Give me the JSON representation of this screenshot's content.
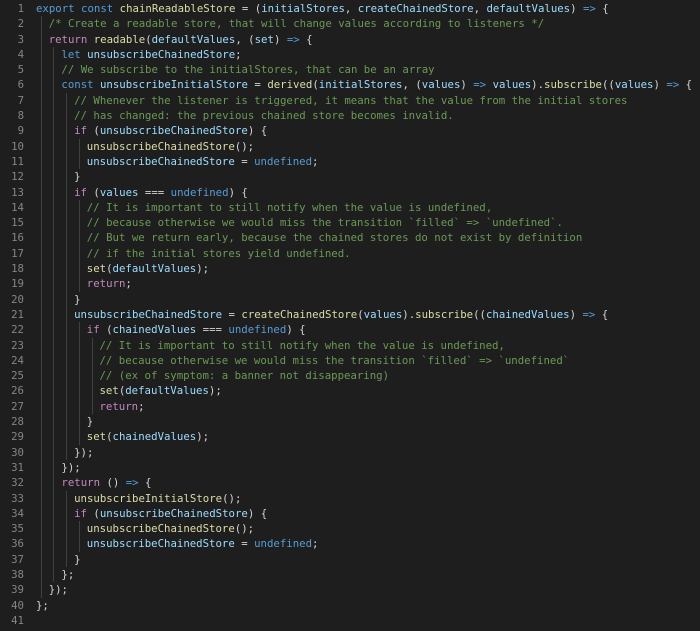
{
  "editor": {
    "lines": [
      {
        "n": "1",
        "indent": 0,
        "t": [
          [
            "kw",
            "export "
          ],
          [
            "kw",
            "const "
          ],
          [
            "fn",
            "chainReadableStore"
          ],
          [
            "tx",
            " = ("
          ],
          [
            "var",
            "initialStores"
          ],
          [
            "tx",
            ", "
          ],
          [
            "var",
            "createChainedStore"
          ],
          [
            "tx",
            ", "
          ],
          [
            "var",
            "defaultValues"
          ],
          [
            "tx",
            ") "
          ],
          [
            "kw",
            "=>"
          ],
          [
            "tx",
            " {"
          ]
        ]
      },
      {
        "n": "2",
        "indent": 1,
        "t": [
          [
            "cm",
            "/* Create a readable store, that will change values according to listeners */"
          ]
        ]
      },
      {
        "n": "3",
        "indent": 1,
        "t": [
          [
            "ctl",
            "return "
          ],
          [
            "fn",
            "readable"
          ],
          [
            "tx",
            "("
          ],
          [
            "var",
            "defaultValues"
          ],
          [
            "tx",
            ", ("
          ],
          [
            "var",
            "set"
          ],
          [
            "tx",
            ") "
          ],
          [
            "kw",
            "=>"
          ],
          [
            "tx",
            " {"
          ]
        ]
      },
      {
        "n": "4",
        "indent": 2,
        "t": [
          [
            "kw",
            "let "
          ],
          [
            "var",
            "unsubscribeChainedStore"
          ],
          [
            "tx",
            ";"
          ]
        ]
      },
      {
        "n": "5",
        "indent": 2,
        "t": [
          [
            "cm",
            "// We subscribe to the initialStores, that can be an array"
          ]
        ]
      },
      {
        "n": "6",
        "indent": 2,
        "t": [
          [
            "kw",
            "const "
          ],
          [
            "var",
            "unsubscribeInitialStore"
          ],
          [
            "tx",
            " = "
          ],
          [
            "fn",
            "derived"
          ],
          [
            "tx",
            "("
          ],
          [
            "var",
            "initialStores"
          ],
          [
            "tx",
            ", ("
          ],
          [
            "var",
            "values"
          ],
          [
            "tx",
            ") "
          ],
          [
            "kw",
            "=>"
          ],
          [
            "tx",
            " "
          ],
          [
            "var",
            "values"
          ],
          [
            "tx",
            ")."
          ],
          [
            "fn",
            "subscribe"
          ],
          [
            "tx",
            "(("
          ],
          [
            "var",
            "values"
          ],
          [
            "tx",
            ") "
          ],
          [
            "kw",
            "=>"
          ],
          [
            "tx",
            " {"
          ]
        ]
      },
      {
        "n": "7",
        "indent": 3,
        "t": [
          [
            "cm",
            "// Whenever the listener is triggered, it means that the value from the initial stores"
          ]
        ]
      },
      {
        "n": "8",
        "indent": 3,
        "t": [
          [
            "cm",
            "// has changed: the previous chained store becomes invalid."
          ]
        ]
      },
      {
        "n": "9",
        "indent": 3,
        "t": [
          [
            "ctl",
            "if "
          ],
          [
            "tx",
            "("
          ],
          [
            "var",
            "unsubscribeChainedStore"
          ],
          [
            "tx",
            ") {"
          ]
        ]
      },
      {
        "n": "10",
        "indent": 4,
        "t": [
          [
            "fn",
            "unsubscribeChainedStore"
          ],
          [
            "tx",
            "();"
          ]
        ]
      },
      {
        "n": "11",
        "indent": 4,
        "t": [
          [
            "var",
            "unsubscribeChainedStore"
          ],
          [
            "tx",
            " = "
          ],
          [
            "un",
            "undefined"
          ],
          [
            "tx",
            ";"
          ]
        ]
      },
      {
        "n": "12",
        "indent": 3,
        "t": [
          [
            "tx",
            "}"
          ]
        ]
      },
      {
        "n": "13",
        "indent": 3,
        "t": [
          [
            "ctl",
            "if "
          ],
          [
            "tx",
            "("
          ],
          [
            "var",
            "values"
          ],
          [
            "tx",
            " === "
          ],
          [
            "un",
            "undefined"
          ],
          [
            "tx",
            ") {"
          ]
        ]
      },
      {
        "n": "14",
        "indent": 4,
        "t": [
          [
            "cm",
            "// It is important to still notify when the value is undefined,"
          ]
        ]
      },
      {
        "n": "15",
        "indent": 4,
        "t": [
          [
            "cm",
            "// because otherwise we would miss the transition `filled` => `undefined`."
          ]
        ]
      },
      {
        "n": "16",
        "indent": 4,
        "t": [
          [
            "cm",
            "// But we return early, because the chained stores do not exist by definition"
          ]
        ]
      },
      {
        "n": "17",
        "indent": 4,
        "t": [
          [
            "cm",
            "// if the initial stores yield undefined."
          ]
        ]
      },
      {
        "n": "18",
        "indent": 4,
        "t": [
          [
            "fn",
            "set"
          ],
          [
            "tx",
            "("
          ],
          [
            "var",
            "defaultValues"
          ],
          [
            "tx",
            ");"
          ]
        ]
      },
      {
        "n": "19",
        "indent": 4,
        "t": [
          [
            "ctl",
            "return"
          ],
          [
            "tx",
            ";"
          ]
        ]
      },
      {
        "n": "20",
        "indent": 3,
        "t": [
          [
            "tx",
            "}"
          ]
        ]
      },
      {
        "n": "21",
        "indent": 3,
        "t": [
          [
            "var",
            "unsubscribeChainedStore"
          ],
          [
            "tx",
            " = "
          ],
          [
            "fn",
            "createChainedStore"
          ],
          [
            "tx",
            "("
          ],
          [
            "var",
            "values"
          ],
          [
            "tx",
            ")."
          ],
          [
            "fn",
            "subscribe"
          ],
          [
            "tx",
            "(("
          ],
          [
            "var",
            "chainedValues"
          ],
          [
            "tx",
            ") "
          ],
          [
            "kw",
            "=>"
          ],
          [
            "tx",
            " {"
          ]
        ]
      },
      {
        "n": "22",
        "indent": 4,
        "t": [
          [
            "ctl",
            "if "
          ],
          [
            "tx",
            "("
          ],
          [
            "var",
            "chainedValues"
          ],
          [
            "tx",
            " === "
          ],
          [
            "un",
            "undefined"
          ],
          [
            "tx",
            ") {"
          ]
        ]
      },
      {
        "n": "23",
        "indent": 5,
        "t": [
          [
            "cm",
            "// It is important to still notify when the value is undefined,"
          ]
        ]
      },
      {
        "n": "24",
        "indent": 5,
        "t": [
          [
            "cm",
            "// because otherwise we would miss the transition `filled` => `undefined`"
          ]
        ]
      },
      {
        "n": "25",
        "indent": 5,
        "t": [
          [
            "cm",
            "// (ex of symptom: a banner not disappearing)"
          ]
        ]
      },
      {
        "n": "26",
        "indent": 5,
        "t": [
          [
            "fn",
            "set"
          ],
          [
            "tx",
            "("
          ],
          [
            "var",
            "defaultValues"
          ],
          [
            "tx",
            ");"
          ]
        ]
      },
      {
        "n": "27",
        "indent": 5,
        "t": [
          [
            "ctl",
            "return"
          ],
          [
            "tx",
            ";"
          ]
        ]
      },
      {
        "n": "28",
        "indent": 4,
        "t": [
          [
            "tx",
            "}"
          ]
        ]
      },
      {
        "n": "29",
        "indent": 4,
        "t": [
          [
            "fn",
            "set"
          ],
          [
            "tx",
            "("
          ],
          [
            "var",
            "chainedValues"
          ],
          [
            "tx",
            ");"
          ]
        ]
      },
      {
        "n": "30",
        "indent": 3,
        "t": [
          [
            "tx",
            "});"
          ]
        ]
      },
      {
        "n": "31",
        "indent": 2,
        "t": [
          [
            "tx",
            "});"
          ]
        ]
      },
      {
        "n": "32",
        "indent": 2,
        "t": [
          [
            "ctl",
            "return "
          ],
          [
            "tx",
            "() "
          ],
          [
            "kw",
            "=>"
          ],
          [
            "tx",
            " {"
          ]
        ]
      },
      {
        "n": "33",
        "indent": 3,
        "t": [
          [
            "fn",
            "unsubscribeInitialStore"
          ],
          [
            "tx",
            "();"
          ]
        ]
      },
      {
        "n": "34",
        "indent": 3,
        "t": [
          [
            "ctl",
            "if "
          ],
          [
            "tx",
            "("
          ],
          [
            "var",
            "unsubscribeChainedStore"
          ],
          [
            "tx",
            ") {"
          ]
        ]
      },
      {
        "n": "35",
        "indent": 4,
        "t": [
          [
            "fn",
            "unsubscribeChainedStore"
          ],
          [
            "tx",
            "();"
          ]
        ]
      },
      {
        "n": "36",
        "indent": 4,
        "t": [
          [
            "var",
            "unsubscribeChainedStore"
          ],
          [
            "tx",
            " = "
          ],
          [
            "un",
            "undefined"
          ],
          [
            "tx",
            ";"
          ]
        ]
      },
      {
        "n": "37",
        "indent": 3,
        "t": [
          [
            "tx",
            "}"
          ]
        ]
      },
      {
        "n": "38",
        "indent": 2,
        "t": [
          [
            "tx",
            "};"
          ]
        ]
      },
      {
        "n": "39",
        "indent": 1,
        "t": [
          [
            "tx",
            "});"
          ]
        ]
      },
      {
        "n": "40",
        "indent": 0,
        "t": [
          [
            "tx",
            "};"
          ]
        ]
      },
      {
        "n": "41",
        "indent": 0,
        "t": []
      }
    ]
  }
}
